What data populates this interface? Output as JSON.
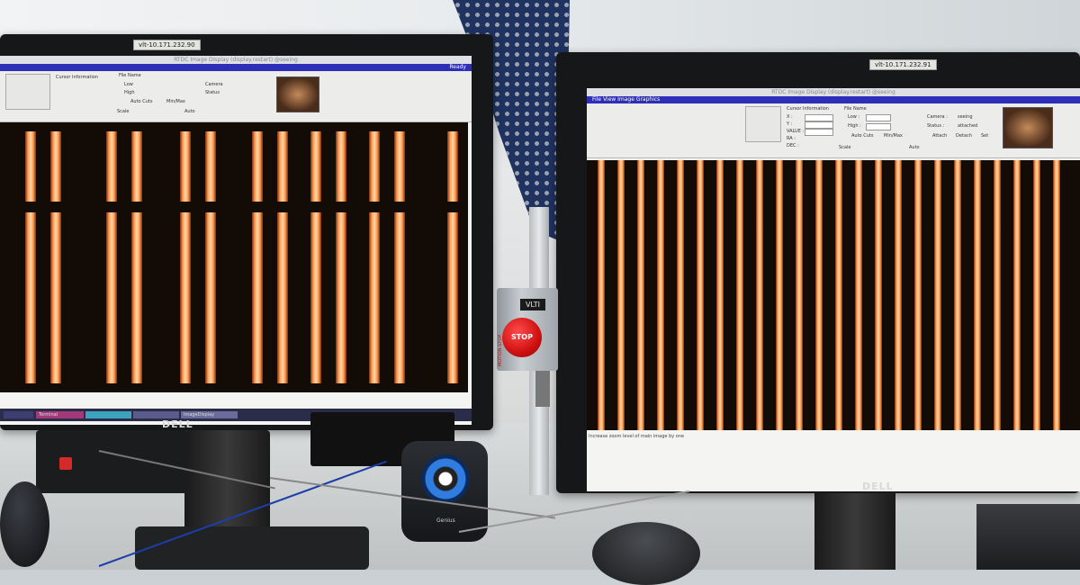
{
  "left_monitor": {
    "bezel_label": "vlt-10.171.232.90",
    "brand": "DELL",
    "window_title": "RTDC Image Display (display.restart) @seeing",
    "menu": "",
    "ready_label": "Ready",
    "cursor_info_label": "Cursor Information",
    "file_name_label": "File Name",
    "low_label": "Low",
    "high_label": "High",
    "camera_label": "Camera",
    "status_label": "Status",
    "auto_cuts_label": "Auto Cuts",
    "min_max_label": "Min/Max",
    "scale_label": "Scale",
    "auto_label": "Auto",
    "taskbar_items": [
      "",
      "Terminal",
      "",
      "",
      "ImageDisplay"
    ]
  },
  "right_monitor": {
    "bezel_label": "vlt-10.171.232.91",
    "brand": "DELL",
    "window_title": "RTDC Image Display (display.restart) @seeing",
    "menu": "File  View  Image  Graphics",
    "cursor_info_label": "Cursor Information",
    "file_name_label": "File Name",
    "low_label": "Low :",
    "high_label": "High :",
    "camera_label": "Camera :",
    "status_label": "Status :",
    "x_label": "X :",
    "y_label": "Y :",
    "value_label": "VALUE :",
    "ra_label": "RA :",
    "dec_label": "DEC :",
    "auto_cuts_label": "Auto Cuts",
    "min_max_label": "Min/Max",
    "attach_label": "Attach",
    "detach_label": "Detach",
    "set_label": "Set",
    "scale_label": "Scale",
    "auto_label": "Auto",
    "camera_value": "seeing",
    "status_value": "attached",
    "status_bar": "Increase zoom level of main image by one"
  },
  "stop_box": {
    "label": "VLTI",
    "button": "STOP",
    "side_label": "MOTION STOP"
  },
  "speaker": {
    "brand": "Genius"
  },
  "colors": {
    "fringe": "#ff9a50",
    "menubar": "#2e2fb8",
    "stop_red": "#d01010",
    "speaker_ring": "#2f7de0"
  }
}
